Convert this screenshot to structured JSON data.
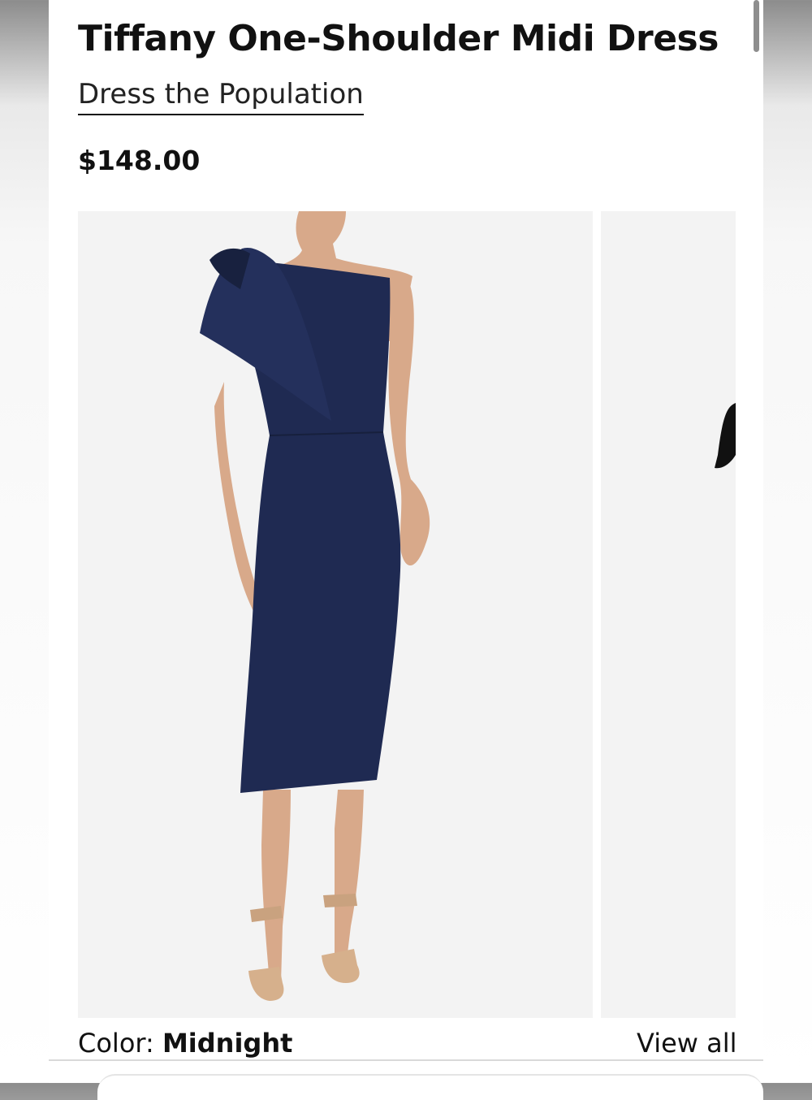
{
  "product": {
    "title": "Tiffany One-Shoulder Midi Dress",
    "brand": "Dress the Population",
    "price": "$148.00"
  },
  "gallery": {
    "image_alt": "navy one-shoulder midi dress with bow",
    "next_image_alt": "next product image, partially visible"
  },
  "color": {
    "label": "Color:",
    "value": "Midnight",
    "view_all_label": "View all"
  },
  "colors": {
    "dress": "#1f2a52",
    "background": "#f3f3f3",
    "text": "#111111"
  }
}
